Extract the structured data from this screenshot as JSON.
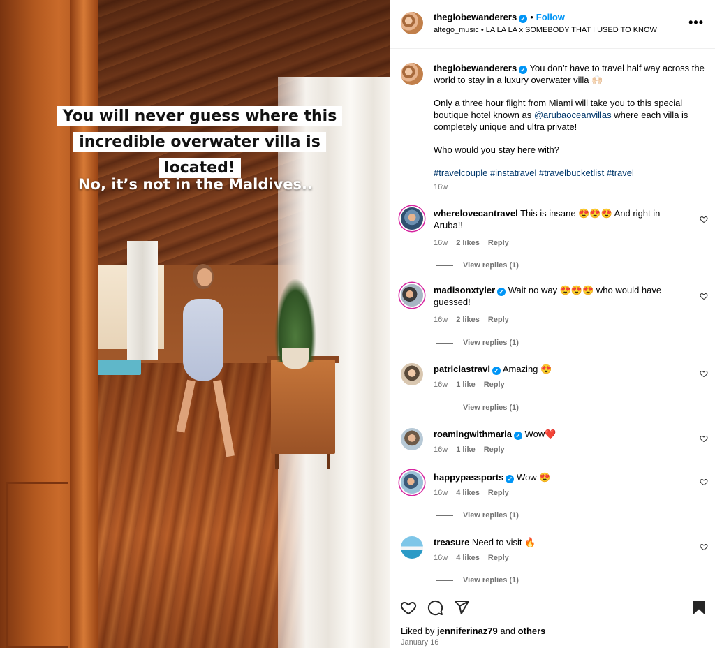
{
  "media": {
    "caption_top": "You will never guess where this incredible overwater villa is located!",
    "caption_bottom": "No, it’s not in the Maldives.."
  },
  "header": {
    "username": "theglobewanderers",
    "separator": "•",
    "follow_label": "Follow",
    "audio": "altego_music • LA LA LA x SOMEBODY THAT I USED TO KNOW",
    "more": "•••"
  },
  "post": {
    "username": "theglobewanderers",
    "line1": " You don’t have to travel half way across the world to stay in a luxury overwater villa 🙌🏻",
    "para2_before": "Only a three hour flight from Miami will take you to this special boutique hotel known as ",
    "para2_mention": "@arubaoceanvillas",
    "para2_after": " where each villa is completely unique and ultra private!",
    "para3": "Who would you stay here with?",
    "hashtags": "#travelcouple #instatravel #travelbucketlist #travel",
    "age": "16w"
  },
  "comments": [
    {
      "user": "wherelovecantravel",
      "verified": false,
      "text": " This is insane 😍😍😍 And right in Aruba!!",
      "age": "16w",
      "likes": "2 likes",
      "reply": "Reply",
      "view_replies": "View replies (1)"
    },
    {
      "user": "madisonxtyler",
      "verified": true,
      "text": " Wait no way 😍😍😍 who would have guessed!",
      "age": "16w",
      "likes": "2 likes",
      "reply": "Reply",
      "view_replies": "View replies (1)"
    },
    {
      "user": "patriciastravl",
      "verified": true,
      "text": " Amazing 😍",
      "age": "16w",
      "likes": "1 like",
      "reply": "Reply",
      "view_replies": "View replies (1)"
    },
    {
      "user": "roamingwithmaria",
      "verified": true,
      "text": " Wow❤️",
      "age": "16w",
      "likes": "1 like",
      "reply": "Reply"
    },
    {
      "user": "happypassports",
      "verified": true,
      "text": " Wow 😍",
      "age": "16w",
      "likes": "4 likes",
      "reply": "Reply",
      "view_replies": "View replies (1)"
    },
    {
      "user": "treasure",
      "verified": false,
      "text": " Need to visit 🔥",
      "age": "16w",
      "likes": "4 likes",
      "reply": "Reply",
      "view_replies": "View replies (1)"
    }
  ],
  "footer": {
    "liked_prefix": "Liked by ",
    "liked_user": "jenniferinaz79",
    "liked_mid": " and ",
    "liked_others": "others",
    "date": "January 16"
  },
  "icons": [
    "heart-icon",
    "comment-icon",
    "share-icon",
    "bookmark-icon",
    "verified-icon",
    "more-icon"
  ],
  "colors": {
    "accent": "#0095f6",
    "link": "#00376b",
    "muted": "#737373"
  }
}
